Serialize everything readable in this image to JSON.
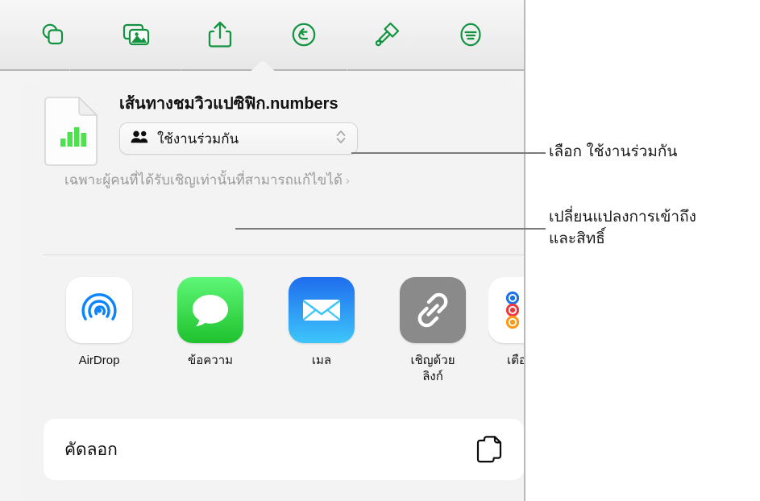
{
  "toolbar": {
    "buttons": [
      {
        "name": "insert-shape-icon",
        "label": "แทรกรูปร่าง"
      },
      {
        "name": "insert-media-icon",
        "label": "แทรกสื่อ"
      },
      {
        "name": "share-icon",
        "label": "แชร์"
      },
      {
        "name": "undo-icon",
        "label": "เลิกทำ"
      },
      {
        "name": "format-brush-icon",
        "label": "รูปแบบ"
      },
      {
        "name": "more-menu-icon",
        "label": "เพิ่มเติม"
      }
    ]
  },
  "share_sheet": {
    "document_title": "เส้นทางชมวิวแปซิฟิก.numbers",
    "file_icon": "numbers-document-icon",
    "share_mode_button": {
      "icon": "two-people-icon",
      "label": "ใช้งานร่วมกัน",
      "stepper_icon": "chevron-up-down-icon"
    },
    "permission_text": "เฉพาะผู้คนที่ได้รับเชิญเท่านั้นที่สามารถแก้ไขได้",
    "permission_chevron": "›",
    "apps": [
      {
        "name": "airdrop",
        "label": "AirDrop",
        "icon": "airdrop-icon"
      },
      {
        "name": "messages",
        "label": "ข้อความ",
        "icon": "messages-icon"
      },
      {
        "name": "mail",
        "label": "เมล",
        "icon": "mail-icon"
      },
      {
        "name": "invite-with-link",
        "label": "เชิญด้วย\nลิงก์",
        "icon": "link-icon"
      },
      {
        "name": "reminders",
        "label": "เตือ",
        "icon": "reminders-icon"
      }
    ],
    "copy_action": {
      "label": "คัดลอก",
      "icon": "copy-documents-icon"
    }
  },
  "annotations": [
    {
      "name": "callout-choose-collaborate",
      "text": "เลือก ใช้งานร่วมกัน"
    },
    {
      "name": "callout-change-access",
      "text": "เปลี่ยนแปลงการเข้าถึง\nและสิทธิ์"
    }
  ],
  "colors": {
    "toolbar_icon_green": "#12933f",
    "numbers_green": "#3fd43f",
    "airdrop_blue": "#0a84ff",
    "messages_green": "#3ad14a",
    "mail_blue": "#1d8dfb",
    "link_gray": "#8a8a8a",
    "reminder_blue": "#1b72e8",
    "reminder_red": "#f0383c",
    "reminder_orange": "#fa9a14",
    "leader_line": "#7a7a7a",
    "permission_gray": "#9a9a9a"
  }
}
